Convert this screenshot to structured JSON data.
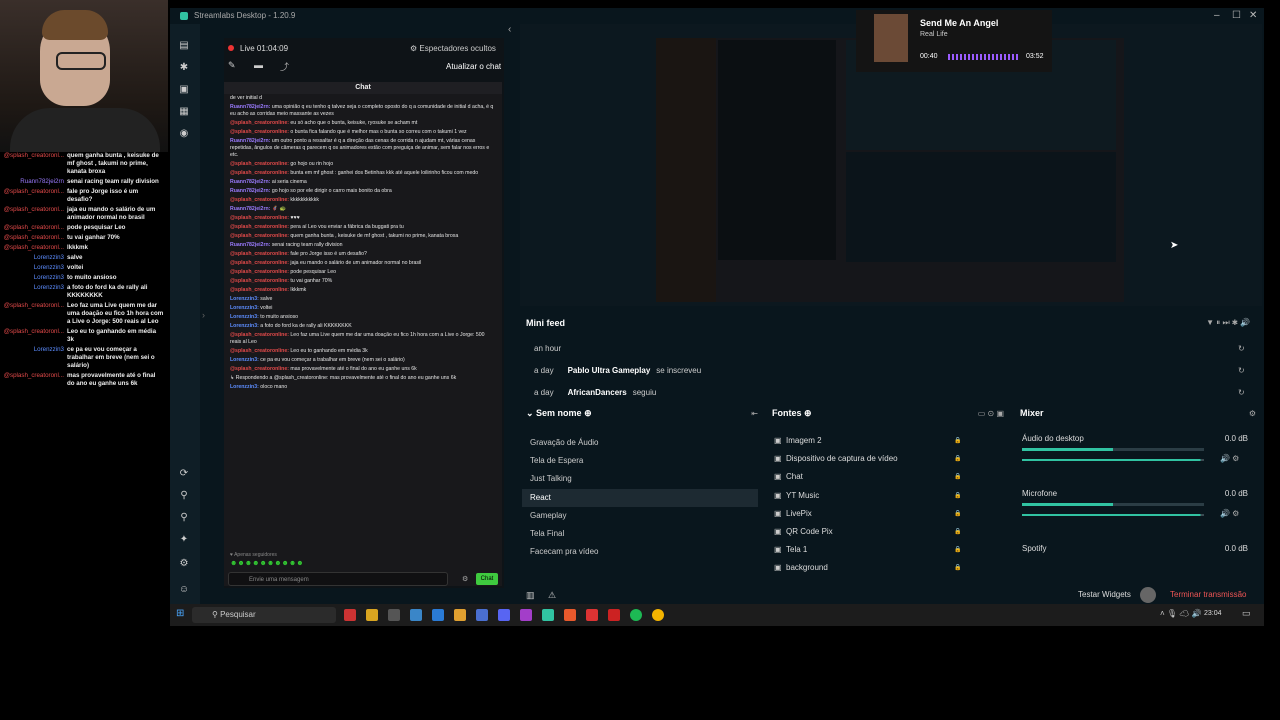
{
  "overlay_chat": [
    {
      "user": "@splash_creatoronl...",
      "msg": "quem ganha bunta , keisuke de mf ghost , takumi no prime, kanata broxa",
      "color": "#e34a4a"
    },
    {
      "user": "Ruann782jei2rn",
      "msg": "senai racing team rally division",
      "color": "#9b7bff"
    },
    {
      "user": "@splash_creatoronl...",
      "msg": "fale pro Jorge isso é um desafio?",
      "color": "#e34a4a"
    },
    {
      "user": "@splash_creatoronl...",
      "msg": "jaja eu mando o salário de um animador normal no brasil",
      "color": "#e34a4a"
    },
    {
      "user": "@splash_creatoronl...",
      "msg": "pode pesquisar Leo",
      "color": "#e34a4a"
    },
    {
      "user": "@splash_creatoronl...",
      "msg": "tu vai ganhar 70%",
      "color": "#e34a4a"
    },
    {
      "user": "@splash_creatoronl...",
      "msg": "lkkkmk",
      "color": "#e34a4a"
    },
    {
      "user": "Lorenzzin3",
      "msg": "salve",
      "color": "#5d8dff"
    },
    {
      "user": "Lorenzzin3",
      "msg": "voltei",
      "color": "#5d8dff"
    },
    {
      "user": "Lorenzzin3",
      "msg": "to muito ansioso",
      "color": "#5d8dff"
    },
    {
      "user": "Lorenzzin3",
      "msg": "a foto do ford ka de rally ali KKKKKKKK",
      "color": "#5d8dff"
    },
    {
      "user": "@splash_creatoronl...",
      "msg": "Leo faz uma Live quem me dar uma doação eu fico 1h hora com a Live o Jorge: 500 reais al Leo",
      "color": "#e34a4a"
    },
    {
      "user": "@splash_creatoronl...",
      "msg": "Leo eu to ganhando em média 3k",
      "color": "#e34a4a"
    },
    {
      "user": "Lorenzzin3",
      "msg": "ce pa eu vou começar a trabalhar em breve (nem sei o salário)",
      "color": "#5d8dff"
    },
    {
      "user": "@splash_creatoronl...",
      "msg": "mas provavelmente até o final do ano eu ganhe uns 6k",
      "color": "#e34a4a"
    }
  ],
  "window": {
    "title": "Streamlabs Desktop - 1.20.9"
  },
  "live": {
    "status": "Live",
    "time": "01:04:09",
    "viewers_label": "Espectadores ocultos",
    "refresh_label": "Atualizar o chat"
  },
  "chat": {
    "header": "Chat",
    "messages": [
      {
        "u": "",
        "c": "",
        "m": "de ver initial d"
      },
      {
        "u": "Ruann782jei2rn:",
        "c": "uP",
        "m": "uma opinião q eu tenho q talvez seja o completo oposto do q a comunidade de initial d acha, é q eu acho as corridas meio massante as vezes"
      },
      {
        "u": "@splash_creatoronline:",
        "c": "uR",
        "m": "eu só acho que o bunta, keisuke, ryosuke se acham mt"
      },
      {
        "u": "@splash_creatoronline:",
        "c": "uR",
        "m": "o bunta fica falando que é melhor mas o bunta so correu com o takumi 1 vez"
      },
      {
        "u": "Ruann782jei2rn:",
        "c": "uP",
        "m": "um outro ponto a ressaltar é q a direção das cenas de corrida n ajudam mt, várias cenas repetidas, ângulos de câmeras q parecem q os animadores estão com preguiça de animar, sem falar nos erros e etc."
      },
      {
        "u": "@splash_creatoronline:",
        "c": "uR",
        "m": "go hojo ou rin hojo"
      },
      {
        "u": "@splash_creatoronline:",
        "c": "uR",
        "m": "bunta em mf ghost : ganhei dos Betinhas kkk até aquele loilirinho ficou com medo"
      },
      {
        "u": "Ruann782jei2rn:",
        "c": "uP",
        "m": "ai seria cinema"
      },
      {
        "u": "Ruann782jei2rn:",
        "c": "uP",
        "m": "go hojo so por ele dirigir o carro mais bonito da obra"
      },
      {
        "u": "@splash_creatoronline:",
        "c": "uR",
        "m": "kkkkkkkkkkk"
      },
      {
        "u": "Ruann782jei2rn:",
        "c": "uP",
        "m": "🦸 🐢"
      },
      {
        "u": "@splash_creatoronline:",
        "c": "uR",
        "m": "♥♥♥"
      },
      {
        "u": "@splash_creatoronline:",
        "c": "uR",
        "m": "pera aí Leo vou enviar a fábrica da buggati pra tu"
      },
      {
        "u": "@splash_creatoronline:",
        "c": "uR",
        "m": "quem ganha bunta , keisuke de mf ghost , takumi no prime, kanata broxa"
      },
      {
        "u": "Ruann782jei2rn:",
        "c": "uP",
        "m": "senai racing team rally division"
      },
      {
        "u": "@splash_creatoronline:",
        "c": "uR",
        "m": "fale pro Jorge isso é um desafio?"
      },
      {
        "u": "@splash_creatoronline:",
        "c": "uR",
        "m": "jaja eu mando o salário de um animador normal no brasil"
      },
      {
        "u": "@splash_creatoronline:",
        "c": "uR",
        "m": "pode pesquisar Leo"
      },
      {
        "u": "@splash_creatoronline:",
        "c": "uR",
        "m": "tu vai ganhar 70%"
      },
      {
        "u": "@splash_creatoronline:",
        "c": "uR",
        "m": "lkkkmk"
      },
      {
        "u": "Lorenzzin3:",
        "c": "uB",
        "m": "salve"
      },
      {
        "u": "Lorenzzin3:",
        "c": "uB",
        "m": "voltei"
      },
      {
        "u": "Lorenzzin3:",
        "c": "uB",
        "m": "to muito ansioso"
      },
      {
        "u": "Lorenzzin3:",
        "c": "uB",
        "m": "a foto do ford ka de rally ali KKKKKKKK"
      },
      {
        "u": "@splash_creatoronline:",
        "c": "uR",
        "m": "Leo faz uma Live quem me dar uma doação eu fico 1h hora com a Live o Jorge: 500 reais al Leo"
      },
      {
        "u": "@splash_creatoronline:",
        "c": "uR",
        "m": "Leo eu to ganhando em média 3k"
      },
      {
        "u": "Lorenzzin3:",
        "c": "uB",
        "m": "ce pa eu vou começar a trabalhar em breve (nem sei o salário)"
      },
      {
        "u": "@splash_creatoronline:",
        "c": "uR",
        "m": "mas provavelmente até o final do ano eu ganhe uns 6k"
      },
      {
        "u": "",
        "c": "",
        "m": "↳ Respondendo a @splash_creatoronline: mas provavelmente até o final do ano eu ganhe uns 6k"
      },
      {
        "u": "Lorenzzin3:",
        "c": "uB",
        "m": "oloco mano"
      }
    ],
    "subs_label": "♥ Apenas seguidores",
    "input_placeholder": "Envie uma mensagem",
    "send_label": "Chat"
  },
  "music": {
    "title": "Send Me An Angel",
    "artist": "Real Life",
    "elapsed": "00:40",
    "total": "03:52"
  },
  "minifeed": {
    "title": "Mini feed",
    "rows": [
      {
        "time": "an hour",
        "name": "",
        "action": ""
      },
      {
        "time": "a day",
        "name": "Pablo Ultra Gameplay",
        "action": "se inscreveu"
      },
      {
        "time": "a day",
        "name": "AfricanDancers",
        "action": "seguiu"
      }
    ]
  },
  "scenes": {
    "title": "Sem nome",
    "items": [
      "Gravação de Áudio",
      "Tela de Espera",
      "Just Talking",
      "React",
      "Gameplay",
      "Tela Final",
      "Facecam pra vídeo"
    ],
    "active": "React"
  },
  "sources": {
    "title": "Fontes",
    "items": [
      "Imagem 2",
      "Dispositivo de captura de vídeo",
      "Chat",
      "YT Music",
      "LivePix",
      "QR Code Pix",
      "Tela 1",
      "background"
    ]
  },
  "mixer": {
    "title": "Mixer",
    "channels": [
      {
        "name": "Áudio do desktop",
        "db": "0.0 dB"
      },
      {
        "name": "Microfone",
        "db": "0.0 dB"
      },
      {
        "name": "Spotify",
        "db": "0.0 dB"
      }
    ]
  },
  "footer": {
    "test_widgets": "Testar Widgets",
    "end_stream": "Terminar transmissão"
  },
  "taskbar": {
    "search": "Pesquisar",
    "time": "23:04"
  }
}
